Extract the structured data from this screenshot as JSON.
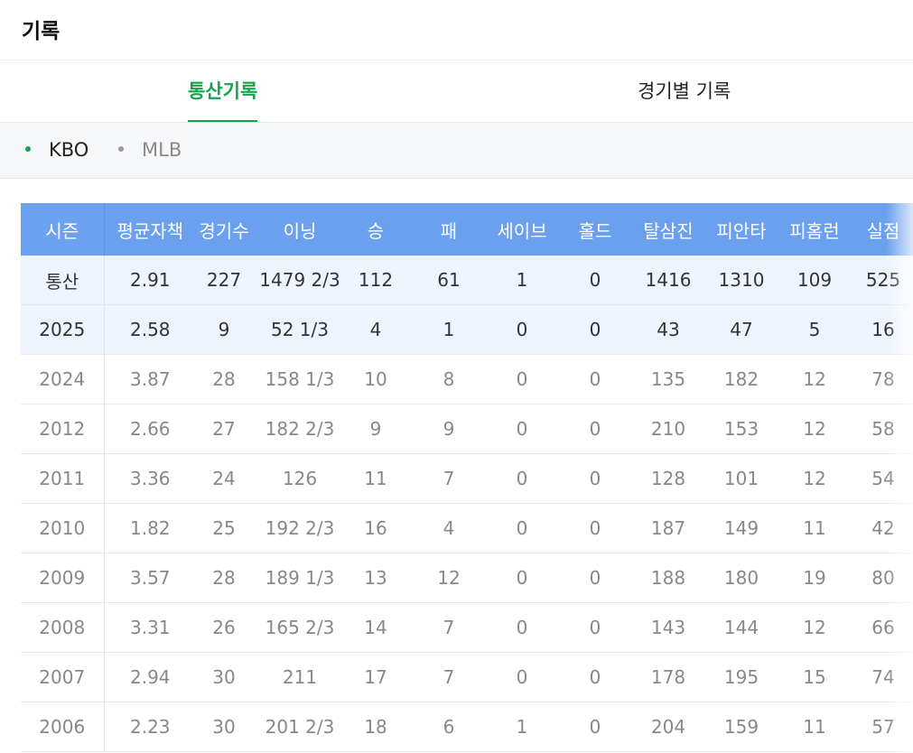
{
  "header": {
    "title": "기록"
  },
  "tabs": [
    {
      "label": "통산기록",
      "active": true
    },
    {
      "label": "경기별 기록",
      "active": false
    }
  ],
  "leagues": [
    {
      "label": "KBO",
      "active": true
    },
    {
      "label": "MLB",
      "active": false
    }
  ],
  "colors": {
    "accent": "#16a34a",
    "table_header": "#6aa0ee",
    "highlight_row": "#eef4fd"
  },
  "table": {
    "columns": [
      "시즌",
      "평균자책",
      "경기수",
      "이닝",
      "승",
      "패",
      "세이브",
      "홀드",
      "탈삼진",
      "피안타",
      "피홈런",
      "실점"
    ],
    "rows": [
      [
        "통산",
        "2.91",
        "227",
        "1479 2/3",
        "112",
        "61",
        "1",
        "0",
        "1416",
        "1310",
        "109",
        "525"
      ],
      [
        "2025",
        "2.58",
        "9",
        "52 1/3",
        "4",
        "1",
        "0",
        "0",
        "43",
        "47",
        "5",
        "16"
      ],
      [
        "2024",
        "3.87",
        "28",
        "158 1/3",
        "10",
        "8",
        "0",
        "0",
        "135",
        "182",
        "12",
        "78"
      ],
      [
        "2012",
        "2.66",
        "27",
        "182 2/3",
        "9",
        "9",
        "0",
        "0",
        "210",
        "153",
        "12",
        "58"
      ],
      [
        "2011",
        "3.36",
        "24",
        "126",
        "11",
        "7",
        "0",
        "0",
        "128",
        "101",
        "12",
        "54"
      ],
      [
        "2010",
        "1.82",
        "25",
        "192 2/3",
        "16",
        "4",
        "0",
        "0",
        "187",
        "149",
        "11",
        "42"
      ],
      [
        "2009",
        "3.57",
        "28",
        "189 1/3",
        "13",
        "12",
        "0",
        "0",
        "188",
        "180",
        "19",
        "80"
      ],
      [
        "2008",
        "3.31",
        "26",
        "165 2/3",
        "14",
        "7",
        "0",
        "0",
        "143",
        "144",
        "12",
        "66"
      ],
      [
        "2007",
        "2.94",
        "30",
        "211",
        "17",
        "7",
        "0",
        "0",
        "178",
        "195",
        "15",
        "74"
      ],
      [
        "2006",
        "2.23",
        "30",
        "201 2/3",
        "18",
        "6",
        "1",
        "0",
        "204",
        "159",
        "11",
        "57"
      ]
    ]
  }
}
